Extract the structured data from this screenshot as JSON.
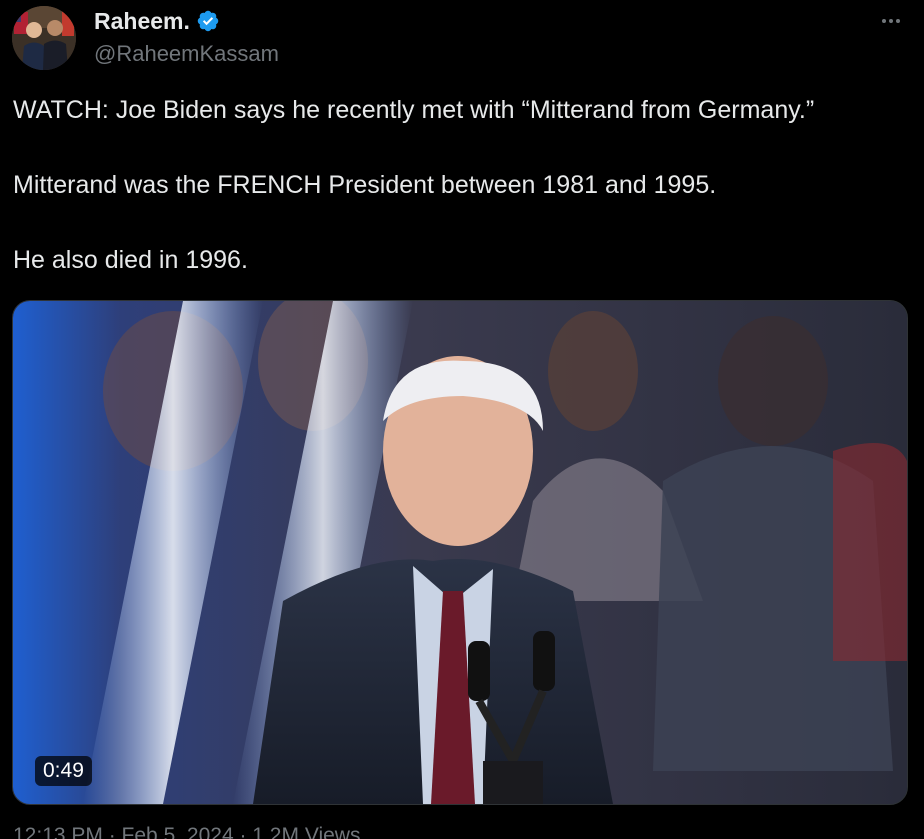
{
  "author": {
    "display_name": "Raheem.",
    "handle": "@RaheemKassam",
    "verified": true,
    "avatar_icon": "profile-photo"
  },
  "more_icon": "ellipsis-icon",
  "tweet": {
    "paragraphs": [
      "WATCH: Joe Biden says he recently met with “Mitterand from Germany.”",
      "Mitterand was the FRENCH President between 1981 and 1995.",
      "He also died in 1996."
    ]
  },
  "media": {
    "type": "video",
    "duration": "0:49"
  },
  "meta": {
    "partial_text": "12:13 PM · Feb 5, 2024 · 1.2M Views"
  },
  "colors": {
    "background": "#000000",
    "text_primary": "#e7e9ea",
    "text_secondary": "#71767b",
    "verified_blue": "#1d9bf0"
  }
}
